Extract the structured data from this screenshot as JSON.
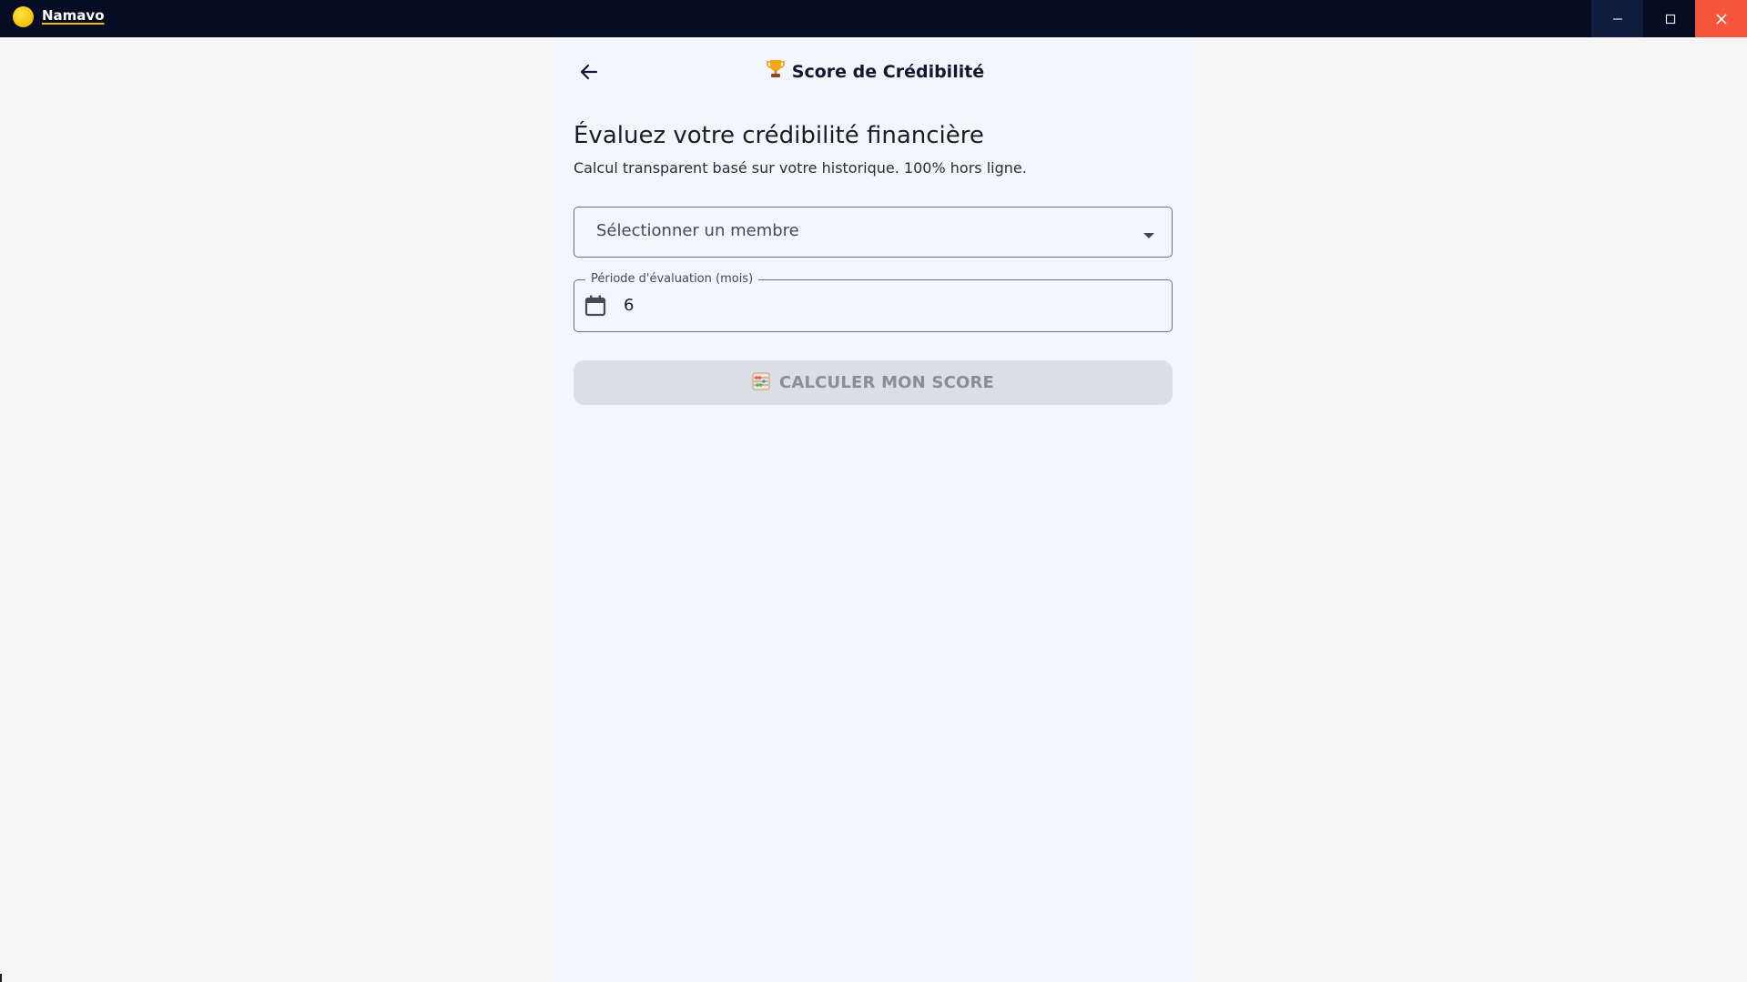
{
  "window": {
    "app_name": "Namavo",
    "minimize_glyph": "—",
    "maximize_glyph": "☐",
    "close_glyph": "✕"
  },
  "header": {
    "title": "Score de Crédibilité",
    "back_icon": "arrow-left-icon",
    "title_icon": "trophy-icon"
  },
  "main": {
    "heading": "Évaluez votre crédibilité financière",
    "subheading": "Calcul transparent basé sur votre historique. 100% hors ligne.",
    "member_select": {
      "placeholder": "Sélectionner un membre",
      "icon": "caret-down-icon"
    },
    "period_field": {
      "label": "Période d'évaluation (mois)",
      "value": "6",
      "icon": "calendar-icon"
    },
    "calculate_button": {
      "label": "CALCULER MON SCORE",
      "icon": "abacus-icon",
      "state": "disabled"
    }
  },
  "colors": {
    "titlebar": "#050c24",
    "content_bg": "#f3f6fc",
    "page_bg": "#f6f6f6",
    "close_button": "#f4553b",
    "button_disabled_bg": "#dcdee5",
    "button_disabled_text": "#8a8d96"
  }
}
